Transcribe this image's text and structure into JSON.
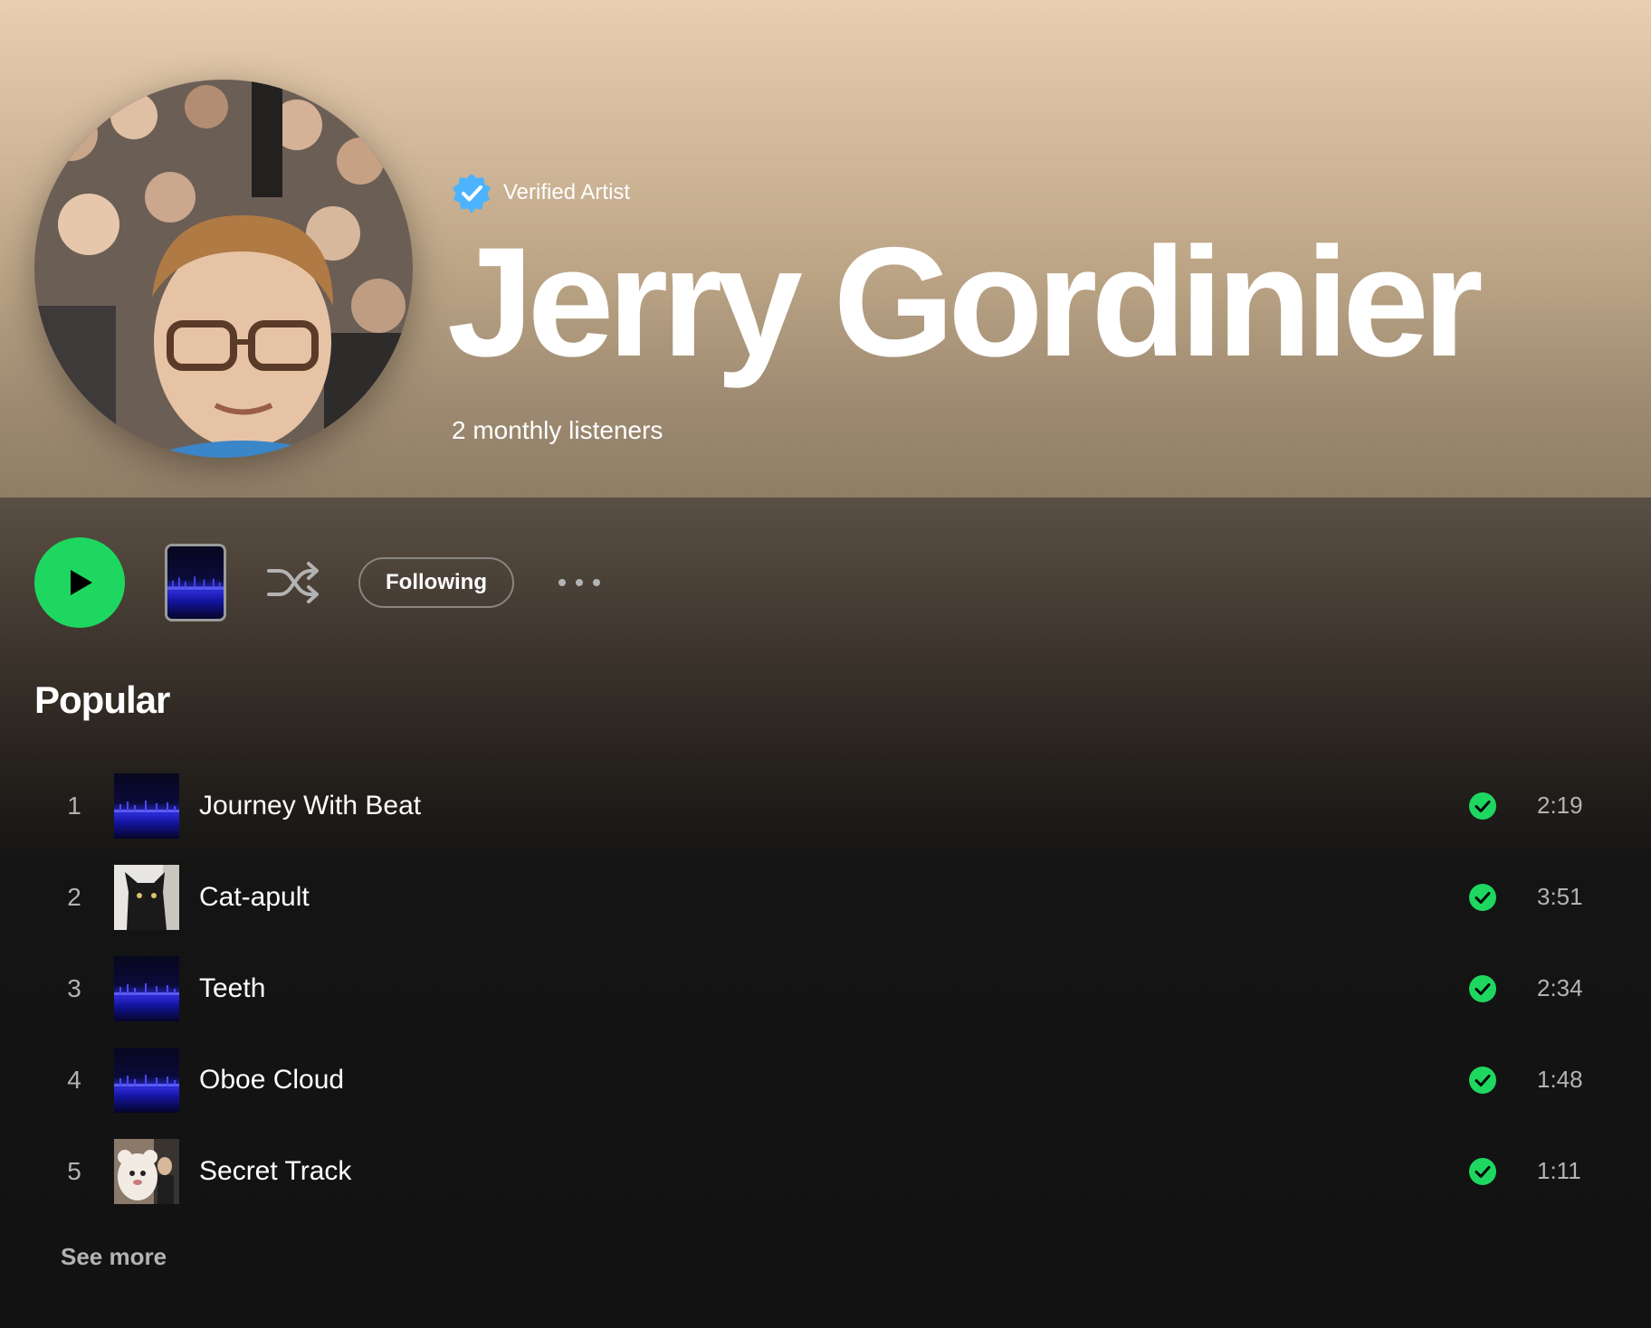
{
  "artist": {
    "verified_label": "Verified Artist",
    "name": "Jerry Gordinier",
    "monthly_listeners": "2 monthly listeners"
  },
  "actions": {
    "following_label": "Following"
  },
  "popular": {
    "title": "Popular",
    "tracks": [
      {
        "number": "1",
        "title": "Journey With Beat",
        "duration": "2:19",
        "art": "blue-stage"
      },
      {
        "number": "2",
        "title": "Cat-apult",
        "duration": "3:51",
        "art": "black-cat"
      },
      {
        "number": "3",
        "title": "Teeth",
        "duration": "2:34",
        "art": "blue-stage"
      },
      {
        "number": "4",
        "title": "Oboe Cloud",
        "duration": "1:48",
        "art": "blue-stage"
      },
      {
        "number": "5",
        "title": "Secret Track",
        "duration": "1:11",
        "art": "mascot-photo"
      }
    ],
    "see_more_label": "See more"
  },
  "colors": {
    "accent_green": "#1ed760",
    "verified_blue": "#4cb3ff",
    "background": "#121212"
  }
}
